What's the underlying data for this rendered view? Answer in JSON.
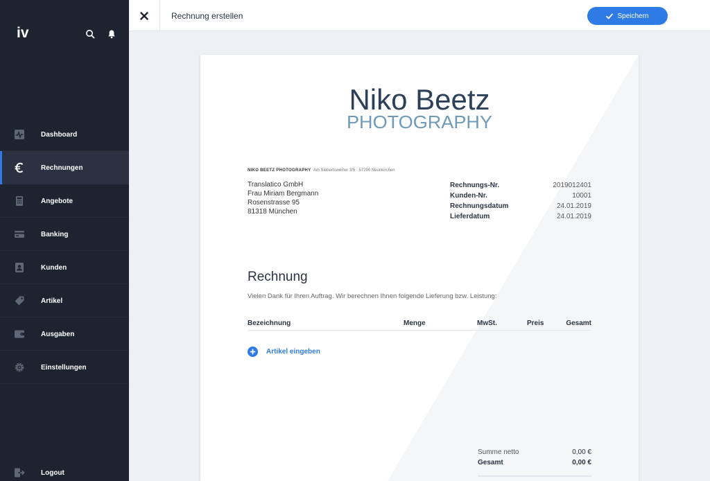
{
  "app": {
    "logo": "iv",
    "search_icon": "search-icon",
    "bell_icon": "bell-icon"
  },
  "sidebar": {
    "items": [
      {
        "label": "Dashboard",
        "icon": "activity-icon"
      },
      {
        "label": "Rechnungen",
        "icon": "euro-icon",
        "active": true
      },
      {
        "label": "Angebote",
        "icon": "calculator-icon"
      },
      {
        "label": "Banking",
        "icon": "credit-card-icon"
      },
      {
        "label": "Kunden",
        "icon": "contact-icon"
      },
      {
        "label": "Artikel",
        "icon": "tag-icon"
      },
      {
        "label": "Ausgaben",
        "icon": "wallet-icon"
      },
      {
        "label": "Einstellungen",
        "icon": "gear-icon"
      }
    ],
    "logout": {
      "label": "Logout",
      "icon": "logout-icon"
    }
  },
  "topbar": {
    "title": "Rechnung erstellen",
    "save_label": "Speichern"
  },
  "document": {
    "brand_name": "Niko Beetz",
    "brand_sub": "PHOTOGRAPHY",
    "sender_name": "NIKO BEETZ PHOTOGRAPHY",
    "sender_address": "Am Siebertsweiher 3/5 · 57290 Neunkirchen",
    "recipient": [
      "Translatico GmbH",
      "Frau Miriam Bergmann",
      "Rosenstrasse 95",
      "81318 München"
    ],
    "meta": [
      {
        "key": "Rechnungs-Nr.",
        "value": "2019012401"
      },
      {
        "key": "Kunden-Nr.",
        "value": "10001"
      },
      {
        "key": "Rechnungsdatum",
        "value": "24.01.2019"
      },
      {
        "key": "Lieferdatum",
        "value": "24.01.2019"
      }
    ],
    "title": "Rechnung",
    "intro": "Vielen Dank für Ihren Auftrag. Wir berechnen Ihnen folgende Lieferung bzw. Leistung:",
    "table_headers": {
      "bezeichnung": "Bezeichnung",
      "menge": "Menge",
      "mwst": "MwSt.",
      "preis": "Preis",
      "gesamt": "Gesamt"
    },
    "add_item_label": "Artikel eingeben",
    "totals": [
      {
        "key": "Summe netto",
        "value": "0,00 €"
      },
      {
        "key": "Gesamt",
        "value": "0,00 €"
      }
    ]
  },
  "colors": {
    "sidebar_bg": "#1e2330",
    "accent": "#2e7be6",
    "brand_dark": "#2c4159",
    "brand_light": "#6f9ab8"
  }
}
